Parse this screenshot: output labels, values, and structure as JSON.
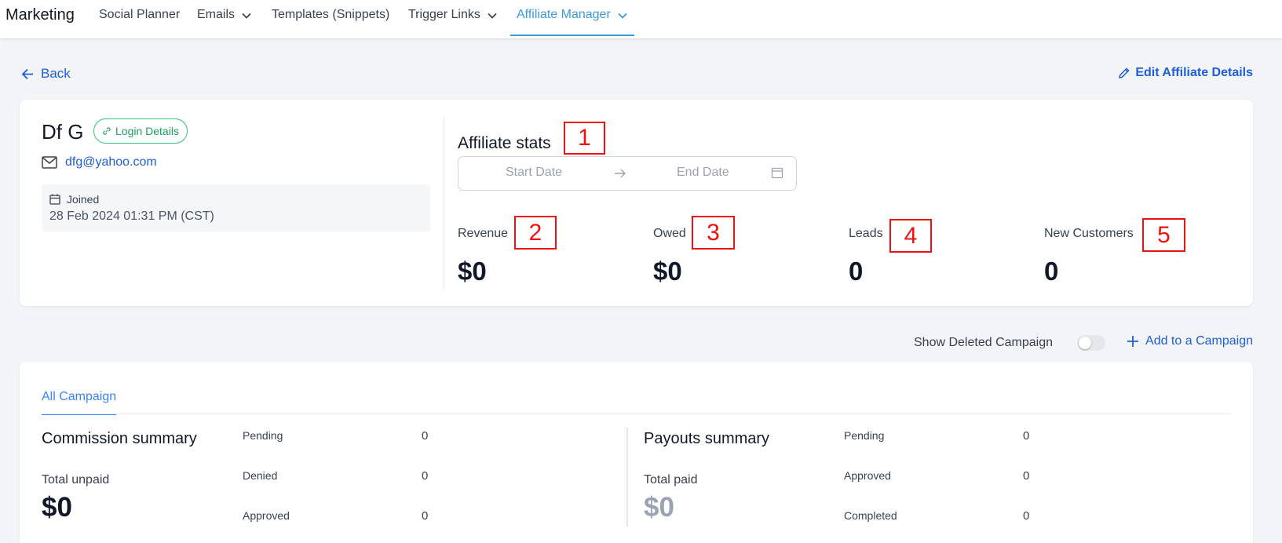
{
  "nav": {
    "brand": "Marketing",
    "items": [
      {
        "label": "Social Planner"
      },
      {
        "label": "Emails"
      },
      {
        "label": "Templates (Snippets)"
      },
      {
        "label": "Trigger Links"
      },
      {
        "label": "Affiliate Manager"
      }
    ]
  },
  "header": {
    "back_label": "Back",
    "edit_label": "Edit Affiliate Details"
  },
  "affiliate": {
    "name": "Df G",
    "login_badge": "Login Details",
    "email": "dfg@yahoo.com",
    "joined_label": "Joined",
    "joined_date": "28 Feb 2024 01:31 PM (CST)"
  },
  "stats": {
    "title": "Affiliate stats",
    "start_placeholder": "Start Date",
    "end_placeholder": "End Date",
    "items": [
      {
        "label": "Revenue",
        "value": "$0"
      },
      {
        "label": "Owed",
        "value": "$0"
      },
      {
        "label": "Leads",
        "value": "0"
      },
      {
        "label": "New Customers",
        "value": "0"
      }
    ]
  },
  "markers": [
    "1",
    "2",
    "3",
    "4",
    "5"
  ],
  "campaign": {
    "show_deleted_label": "Show Deleted Campaign",
    "add_label": "Add to a Campaign",
    "tab_all": "All Campaign"
  },
  "commission": {
    "title": "Commission summary",
    "total_label": "Total unpaid",
    "total_value": "$0",
    "rows": [
      {
        "label": "Pending",
        "value": "0"
      },
      {
        "label": "Denied",
        "value": "0"
      },
      {
        "label": "Approved",
        "value": "0"
      }
    ]
  },
  "payouts": {
    "title": "Payouts summary",
    "total_label": "Total paid",
    "total_value": "$0",
    "rows": [
      {
        "label": "Pending",
        "value": "0"
      },
      {
        "label": "Approved",
        "value": "0"
      },
      {
        "label": "Completed",
        "value": "0"
      }
    ]
  }
}
